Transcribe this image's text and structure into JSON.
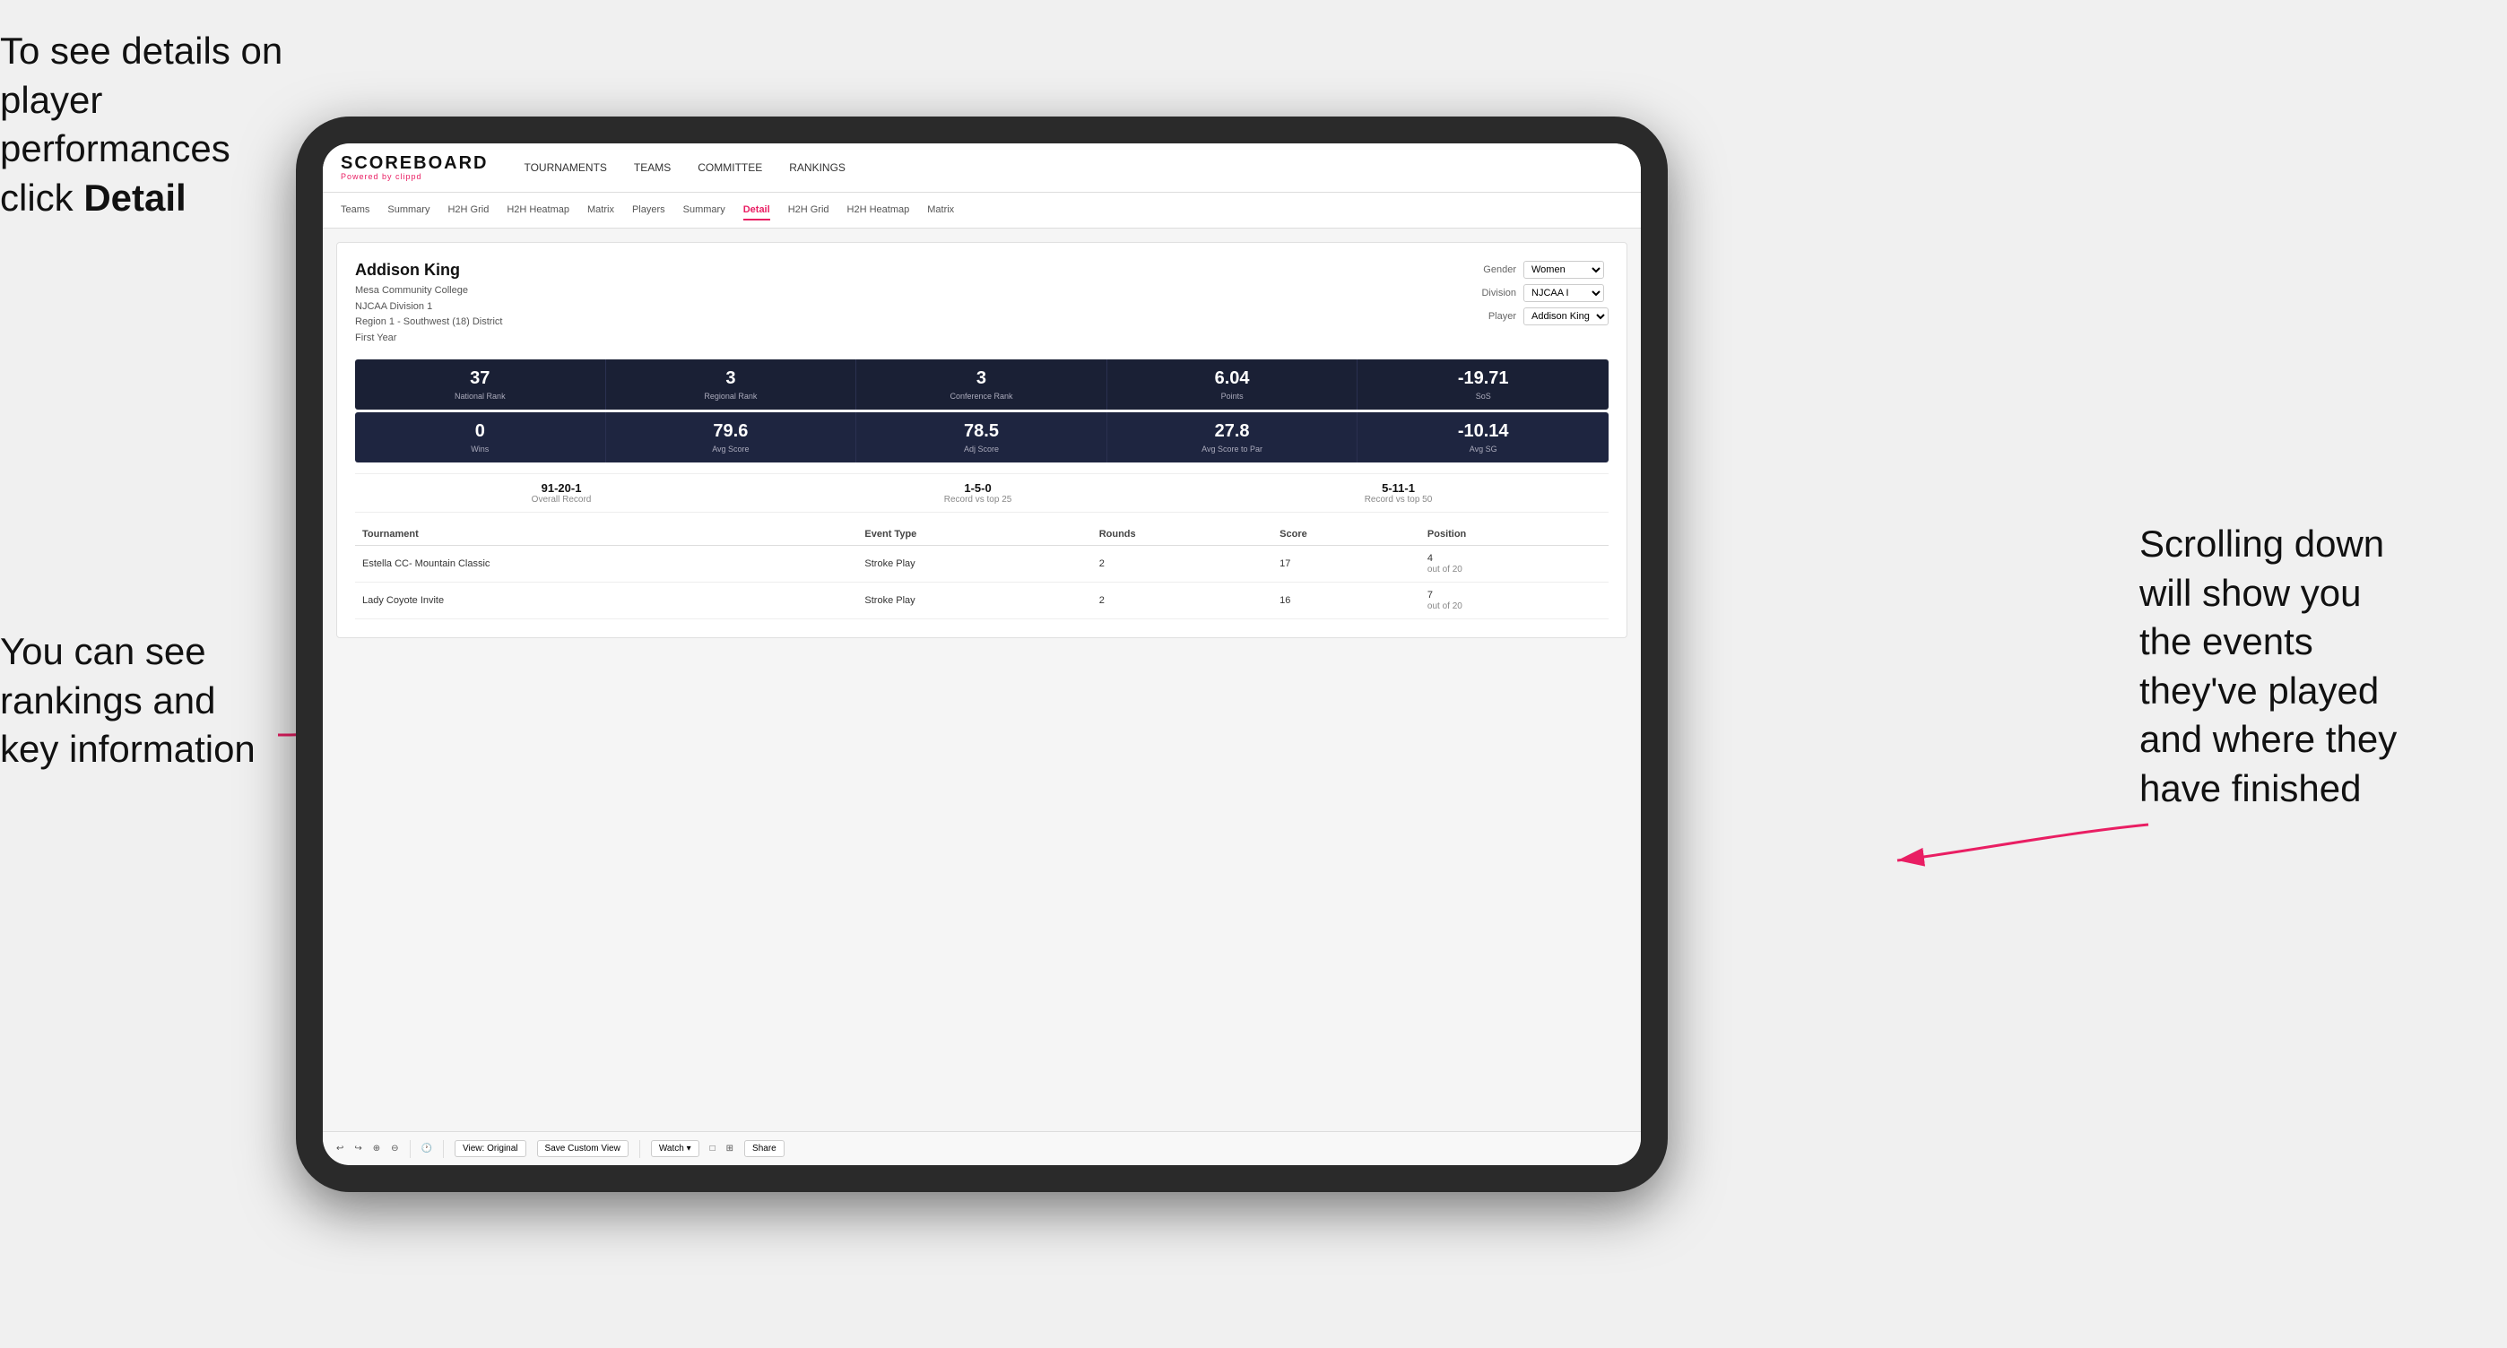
{
  "annotations": {
    "top_left": {
      "line1": "To see details on",
      "line2": "player performances",
      "line3_prefix": "click ",
      "line3_bold": "Detail"
    },
    "bottom_left": {
      "line1": "You can see",
      "line2": "rankings and",
      "line3": "key information"
    },
    "right": {
      "line1": "Scrolling down",
      "line2": "will show you",
      "line3": "the events",
      "line4": "they've played",
      "line5": "and where they",
      "line6": "have finished"
    }
  },
  "nav": {
    "logo": "SCOREBOARD",
    "powered_by": "Powered by ",
    "powered_brand": "clippd",
    "items": [
      {
        "label": "TOURNAMENTS",
        "active": false
      },
      {
        "label": "TEAMS",
        "active": false
      },
      {
        "label": "COMMITTEE",
        "active": false
      },
      {
        "label": "RANKINGS",
        "active": false
      }
    ]
  },
  "sub_nav": {
    "items": [
      {
        "label": "Teams",
        "active": false
      },
      {
        "label": "Summary",
        "active": false
      },
      {
        "label": "H2H Grid",
        "active": false
      },
      {
        "label": "H2H Heatmap",
        "active": false
      },
      {
        "label": "Matrix",
        "active": false
      },
      {
        "label": "Players",
        "active": false
      },
      {
        "label": "Summary",
        "active": false
      },
      {
        "label": "Detail",
        "active": true
      },
      {
        "label": "H2H Grid",
        "active": false
      },
      {
        "label": "H2H Heatmap",
        "active": false
      },
      {
        "label": "Matrix",
        "active": false
      }
    ]
  },
  "player": {
    "name": "Addison King",
    "school": "Mesa Community College",
    "division": "NJCAA Division 1",
    "region": "Region 1 - Southwest (18) District",
    "year": "First Year"
  },
  "filters": {
    "gender_label": "Gender",
    "gender_value": "Women",
    "division_label": "Division",
    "division_value": "NJCAA I",
    "player_label": "Player",
    "player_value": "Addison King"
  },
  "stats_row1": [
    {
      "value": "37",
      "label": "National Rank"
    },
    {
      "value": "3",
      "label": "Regional Rank"
    },
    {
      "value": "3",
      "label": "Conference Rank"
    },
    {
      "value": "6.04",
      "label": "Points"
    },
    {
      "value": "-19.71",
      "label": "SoS"
    }
  ],
  "stats_row2": [
    {
      "value": "0",
      "label": "Wins"
    },
    {
      "value": "79.6",
      "label": "Avg Score"
    },
    {
      "value": "78.5",
      "label": "Adj Score"
    },
    {
      "value": "27.8",
      "label": "Avg Score to Par"
    },
    {
      "value": "-10.14",
      "label": "Avg SG"
    }
  ],
  "records": [
    {
      "value": "91-20-1",
      "label": "Overall Record"
    },
    {
      "value": "1-5-0",
      "label": "Record vs top 25"
    },
    {
      "value": "5-11-1",
      "label": "Record vs top 50"
    }
  ],
  "table": {
    "headers": [
      "Tournament",
      "Event Type",
      "Rounds",
      "Score",
      "Position"
    ],
    "rows": [
      {
        "tournament": "Estella CC- Mountain Classic",
        "event_type": "Stroke Play",
        "rounds": "2",
        "score": "17",
        "position": "4\nout of 20"
      },
      {
        "tournament": "Lady Coyote Invite",
        "event_type": "Stroke Play",
        "rounds": "2",
        "score": "16",
        "position": "7\nout of 20"
      }
    ]
  },
  "toolbar": {
    "buttons": [
      "View: Original",
      "Save Custom View",
      "Watch ▾",
      "Share"
    ]
  }
}
